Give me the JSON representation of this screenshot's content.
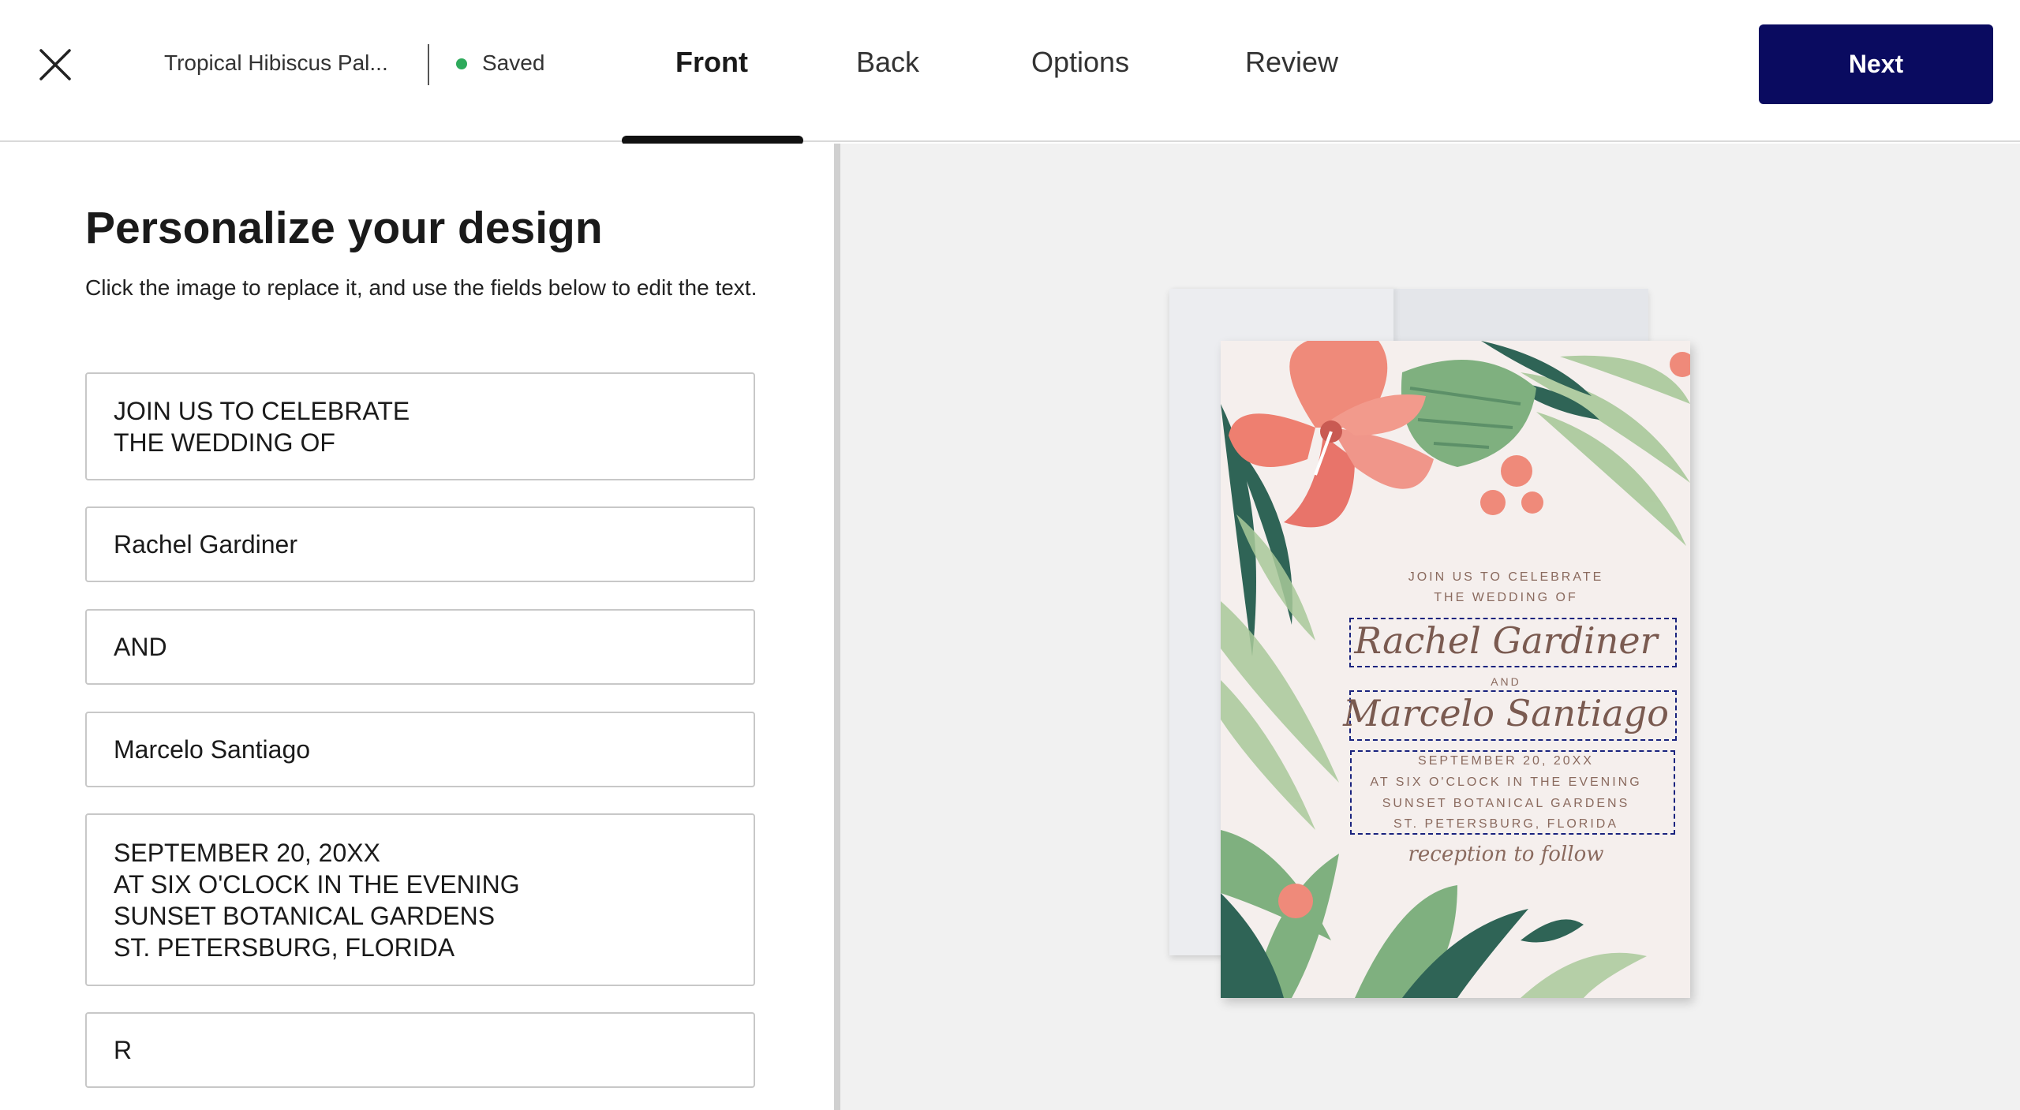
{
  "header": {
    "doc_title": "Tropical Hibiscus Pal...",
    "status": "Saved",
    "tabs": [
      {
        "label": "Front",
        "active": true
      },
      {
        "label": "Back",
        "active": false
      },
      {
        "label": "Options",
        "active": false
      },
      {
        "label": "Review",
        "active": false
      }
    ],
    "next_label": "Next",
    "colors": {
      "accent": "#0a0b60",
      "saved_dot": "#2eaa5c"
    }
  },
  "panel": {
    "heading": "Personalize your design",
    "subtext": "Click the image to replace it, and use the fields below to edit the text.",
    "fields": [
      {
        "value": "JOIN US TO CELEBRATE\nTHE WEDDING OF"
      },
      {
        "value": "Rachel Gardiner"
      },
      {
        "value": "AND"
      },
      {
        "value": "Marcelo Santiago"
      },
      {
        "value": "SEPTEMBER 20, 20XX\nAT SIX O'CLOCK IN THE EVENING\nSUNSET BOTANICAL GARDENS\nST. PETERSBURG, FLORIDA"
      },
      {
        "value": "R"
      }
    ]
  },
  "card": {
    "line1": "JOIN US TO CELEBRATE",
    "line2": "THE WEDDING OF",
    "name1": "Rachel Gardiner",
    "and": "AND",
    "name2": "Marcelo Santiago",
    "details": [
      "SEPTEMBER 20, 20XX",
      "AT SIX O'CLOCK IN THE EVENING",
      "SUNSET BOTANICAL GARDENS",
      "ST. PETERSBURG, FLORIDA"
    ],
    "reception": "reception to follow"
  }
}
